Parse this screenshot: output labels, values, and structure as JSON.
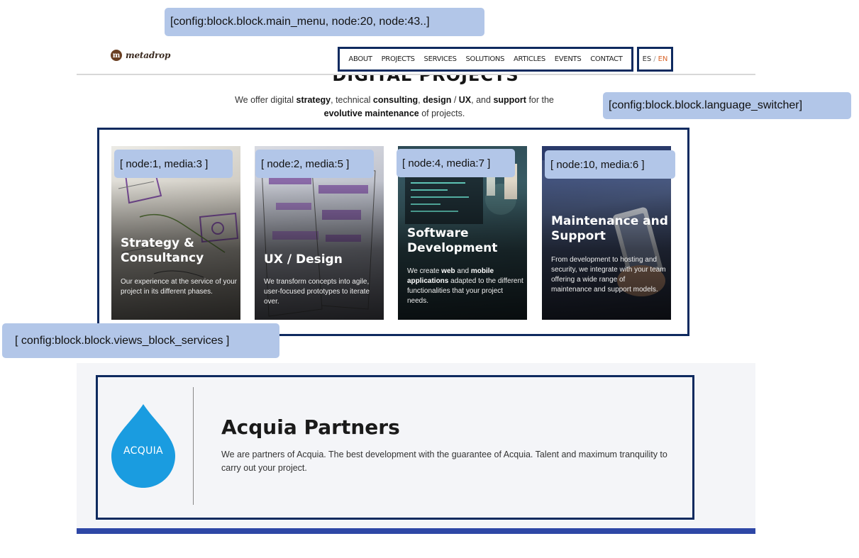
{
  "brand": {
    "logo_letter": "m",
    "name": "metadrop"
  },
  "main_menu": {
    "items": [
      "ABOUT",
      "PROJECTS",
      "SERVICES",
      "SOLUTIONS",
      "ARTICLES",
      "EVENTS",
      "CONTACT"
    ]
  },
  "language_switcher": {
    "es": "ES",
    "separator": "/",
    "en": "EN"
  },
  "annotations": {
    "main_menu": "[config:block.block.main_menu, node:20, node:43..]",
    "language_switcher": "[config:block.block.language_switcher]",
    "views_block_services": "[ config:block.block.views_block_services ]",
    "card1": "[ node:1, media:3 ]",
    "card2": "[ node:2, media:5 ]",
    "card3": "[ node:4, media:7 ]",
    "card4": "[ node:10, media:6 ]"
  },
  "hero": {
    "heading": "DIGITAL PROJECTS",
    "intro_1": "We offer digital ",
    "intro_strategy": "strategy",
    "intro_2": ", technical ",
    "intro_consulting": "consulting",
    "intro_3": ", ",
    "intro_design": "design",
    "intro_4": " / ",
    "intro_ux": "UX",
    "intro_5": ", and ",
    "intro_support": "support",
    "intro_6": " for the ",
    "intro_maintenance": "evolutive maintenance",
    "intro_7": " of projects."
  },
  "services": [
    {
      "title": "Strategy & Consultancy",
      "text": "Our experience at the service of your project in its different phases."
    },
    {
      "title": "UX / Design",
      "text": "We transform concepts into agile, user-focused prototypes to iterate over."
    },
    {
      "title": "Software Development",
      "text_1": "We create ",
      "text_web": "web",
      "text_2": " and ",
      "text_mobile": "mobile applications",
      "text_3": " adapted to the different functionalities that your project needs."
    },
    {
      "title": "Maintenance and Support",
      "text": "From development to hosting and security, we integrate with your team offering a wide range of maintenance and support models."
    }
  ],
  "acquia": {
    "logo_text": "Acquia",
    "title": "Acquia Partners",
    "text": "We are partners of Acquia. The best development with the guarantee of Acquia. Talent and maximum tranquility to carry out your project."
  },
  "colors": {
    "outline": "#0e2a5f",
    "tag_bg": "#b2c6e8",
    "acquia_blue": "#1a9ce0",
    "lang_active": "#d8642a",
    "footer_bar": "#2e47a6"
  }
}
